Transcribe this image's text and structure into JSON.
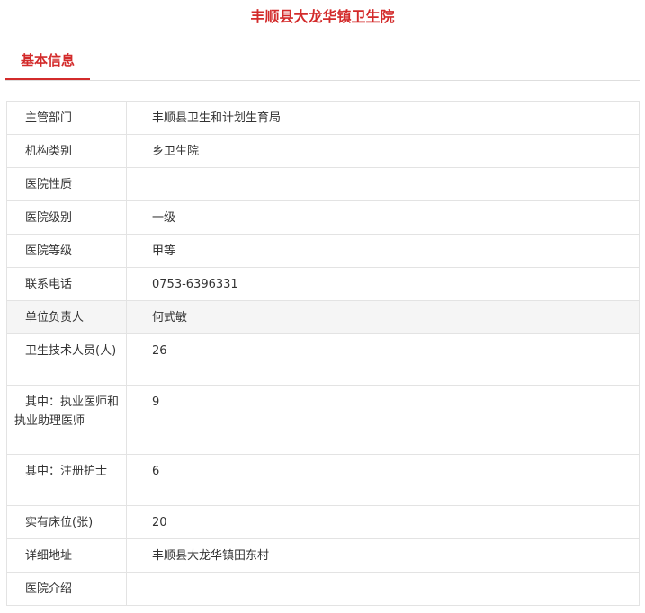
{
  "page": {
    "title": "丰顺县大龙华镇卫生院"
  },
  "tabs": [
    {
      "label": "基本信息",
      "active": true
    }
  ],
  "colors": {
    "accent": "#d32b2b",
    "border": "#e3e3e3",
    "highlight_row": "#f5f5f5"
  },
  "info": {
    "rows": [
      {
        "label": "主管部门",
        "value": "丰顺县卫生和计划生育局"
      },
      {
        "label": "机构类别",
        "value": "乡卫生院"
      },
      {
        "label": "医院性质",
        "value": ""
      },
      {
        "label": "医院级别",
        "value": "一级"
      },
      {
        "label": "医院等级",
        "value": "甲等"
      },
      {
        "label": "联系电话",
        "value": "0753-6396331"
      },
      {
        "label": "单位负责人",
        "value": "何式敏"
      },
      {
        "label": "卫生技术人员(人)",
        "value": "26"
      },
      {
        "label": "其中：执业医师和执业助理医师",
        "value": "9"
      },
      {
        "label": "其中：注册护士",
        "value": "6"
      },
      {
        "label": "实有床位(张)",
        "value": "20"
      },
      {
        "label": "详细地址",
        "value": "丰顺县大龙华镇田东村"
      },
      {
        "label": "医院介绍",
        "value": ""
      }
    ]
  }
}
